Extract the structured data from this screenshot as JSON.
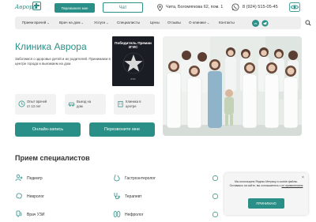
{
  "header": {
    "logo_text": "Аврора",
    "call_button": "Перезвоните мне",
    "chat_button": "Чат",
    "address": "Чита, Богомягкова 62, пом. 1",
    "phone": "8 (924) 515-05-45",
    "accent_color": "#2a8f86"
  },
  "nav": {
    "items": [
      {
        "label": "Прием врачей",
        "has_dropdown": true
      },
      {
        "label": "Врач на дом",
        "has_dropdown": true
      },
      {
        "label": "Услуги",
        "has_dropdown": true
      },
      {
        "label": "Специалисты",
        "has_dropdown": false
      },
      {
        "label": "Цены",
        "has_dropdown": false
      },
      {
        "label": "Отзывы",
        "has_dropdown": false
      },
      {
        "label": "О клинике",
        "has_dropdown": true
      },
      {
        "label": "Контакты",
        "has_dropdown": false
      }
    ],
    "chevron": "⌄",
    "icons": [
      "vk-icon",
      "telegram-icon",
      "search-icon"
    ],
    "vk_glyph": "vk"
  },
  "hero": {
    "title": "Клиника Аврора",
    "text": "Заботимся о здоровье детей и их родителей. Принимаем в центре города и выезжаем на дом.",
    "award_title": "Победитель Премии 2ГИС",
    "award_footer": "2ГИС"
  },
  "features": [
    {
      "line1": "Опыт врачей",
      "line2": "от 13 лет"
    },
    {
      "line1": "Выезд на",
      "line2": "дом"
    },
    {
      "line1": "Клиника в",
      "line2": "центре"
    }
  ],
  "actions": {
    "online_label": "Онлайн-запись",
    "call_label": "Перезвоните мне"
  },
  "specialists": {
    "title": "Прием специалистов",
    "items": [
      {
        "label": "Педиатр"
      },
      {
        "label": "Невролог"
      },
      {
        "label": "Врач УЗИ"
      },
      {
        "label": "Гастроэнтеролог"
      },
      {
        "label": "Терапевт"
      },
      {
        "label": "Нефролог"
      }
    ]
  },
  "cookie": {
    "text_main": "Мы используем Яндекс.Метрику и cookie файлы. Оставаясь на сайте, вы соглашаетесь с",
    "text_link": "их применением",
    "button": "ПРИНИМАЮ",
    "close": "×"
  }
}
